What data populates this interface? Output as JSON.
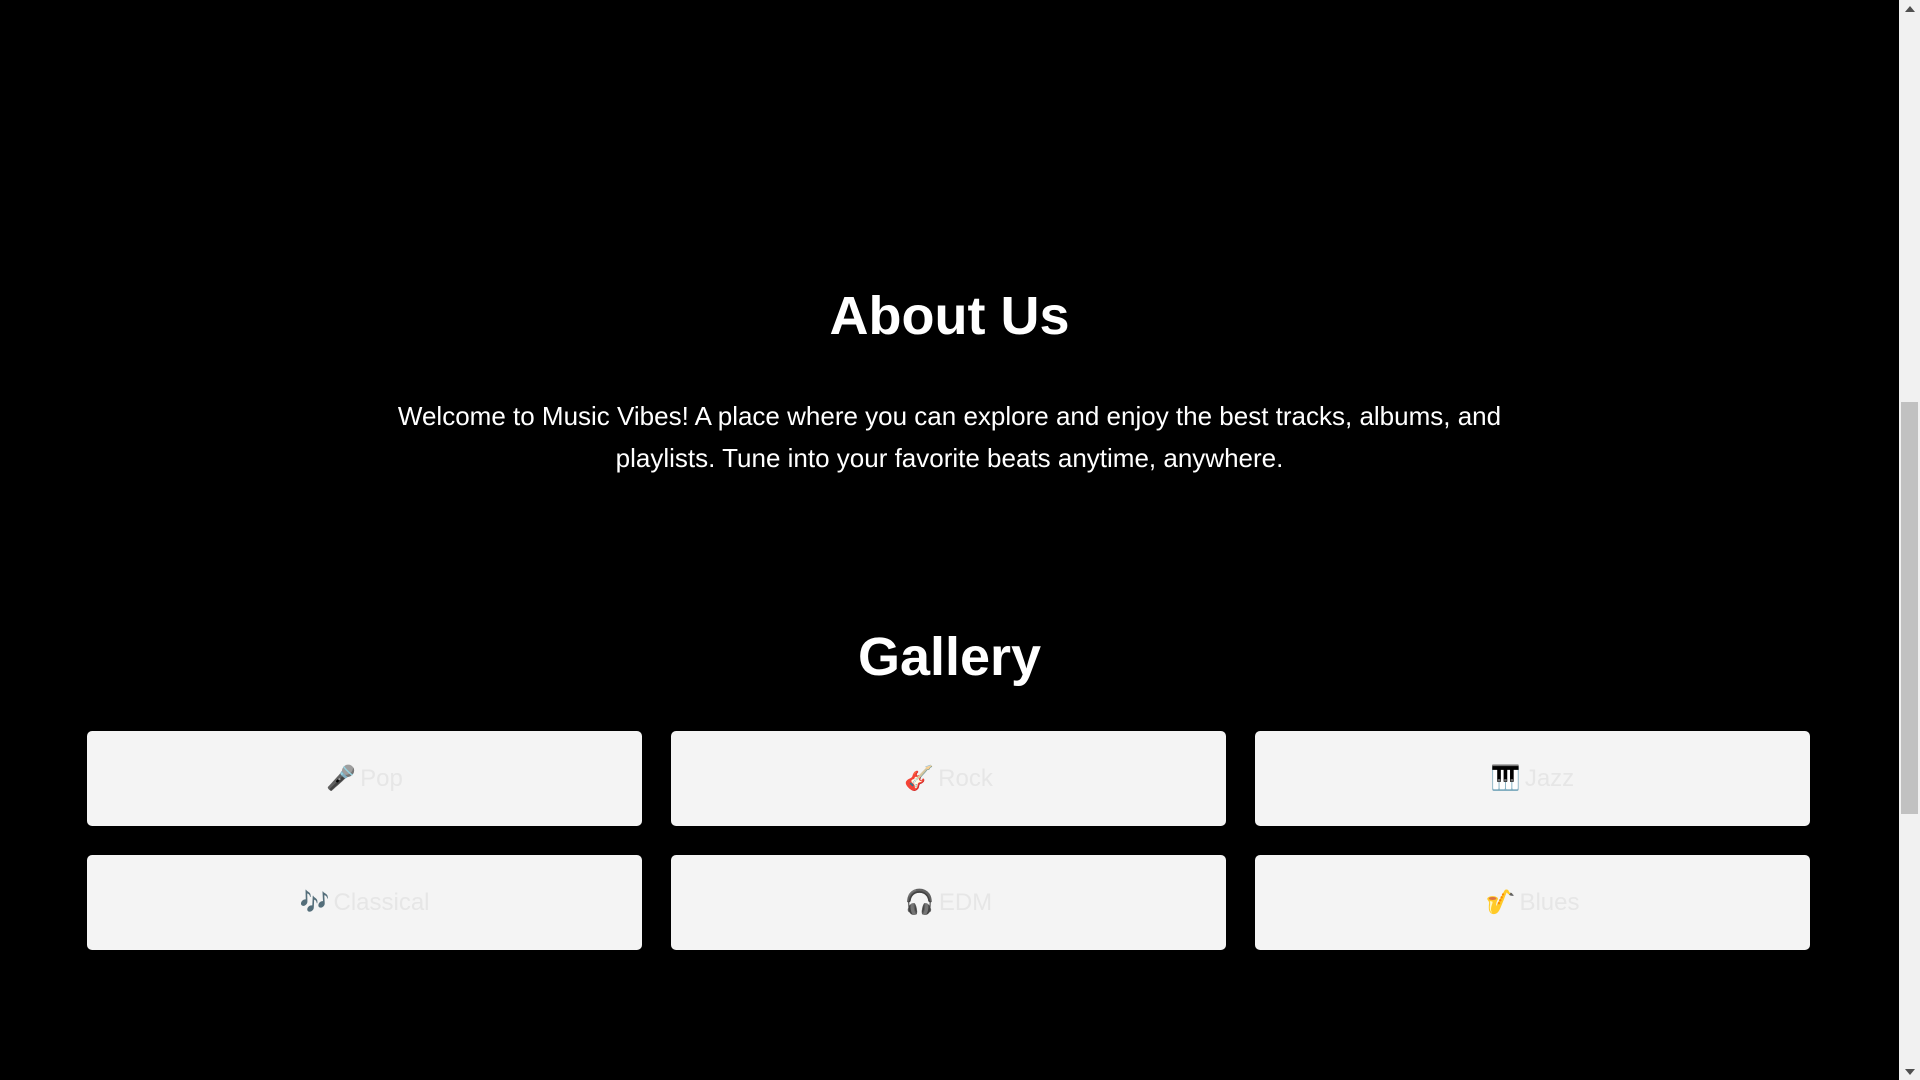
{
  "about": {
    "title": "About Us",
    "text": "Welcome to Music Vibes! A place where you can explore and enjoy the best tracks, albums, and playlists. Tune into your favorite beats anytime, anywhere."
  },
  "gallery": {
    "title": "Gallery",
    "items": [
      {
        "icon": "microphone-icon",
        "emoji": "🎤",
        "label": "Pop"
      },
      {
        "icon": "guitar-icon",
        "emoji": "🎸",
        "label": "Rock"
      },
      {
        "icon": "piano-icon",
        "emoji": "🎹",
        "label": "Jazz"
      },
      {
        "icon": "music-notes-icon",
        "emoji": "🎶",
        "label": "Classical"
      },
      {
        "icon": "headphones-icon",
        "emoji": "🎧",
        "label": "EDM"
      },
      {
        "icon": "saxophone-icon",
        "emoji": "🎷",
        "label": "Blues"
      }
    ]
  },
  "colors": {
    "background": "#000000",
    "heading_text": "#ffffff",
    "card_background": "#f4f4f4",
    "card_label_text": "#e6e6e6"
  }
}
